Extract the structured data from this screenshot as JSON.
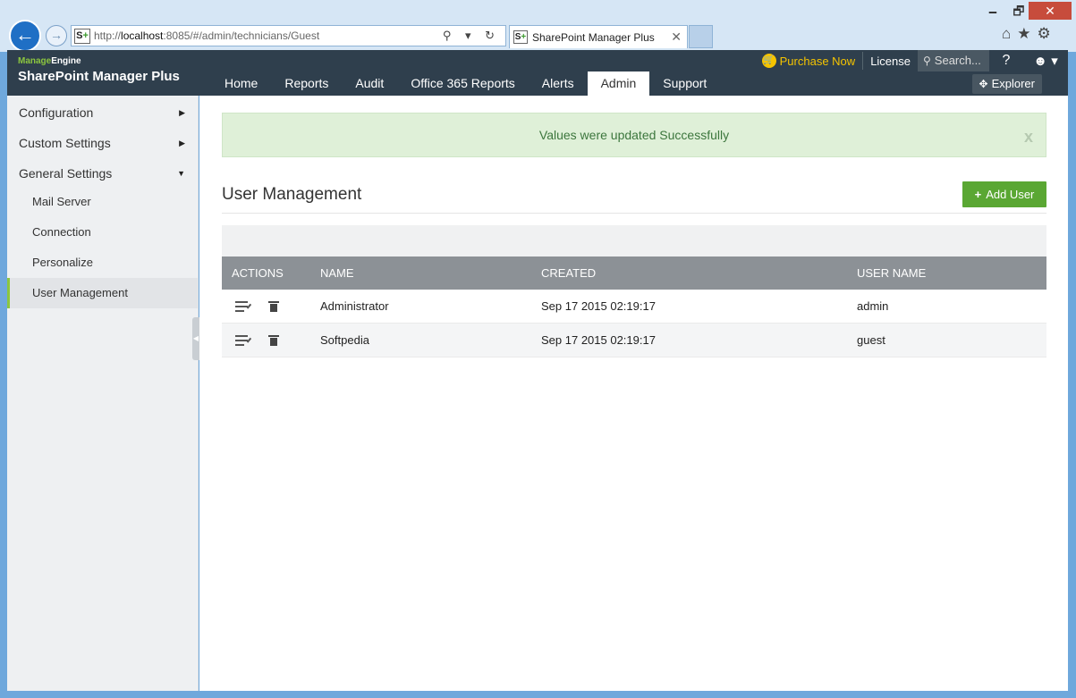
{
  "window": {
    "minimize": "🗕",
    "maximize": "🗗",
    "close": "✕"
  },
  "browser": {
    "back": "←",
    "forward": "→",
    "url_prefix": "http://",
    "url_host": "localhost",
    "url_rest": ":8085/#/admin/technicians/Guest",
    "favicon": "S",
    "favicon_plus": "+",
    "address_icons": "⚲ ▾ ↻",
    "tab_title": "SharePoint Manager Plus",
    "tab_close": "✕",
    "toolbar_icons": "⌂★⚙"
  },
  "header": {
    "brand_small_prefix": "Manage",
    "brand_small_suffix": "Engine",
    "brand_name": "SharePoint Manager Plus",
    "nav": [
      {
        "label": "Home"
      },
      {
        "label": "Reports"
      },
      {
        "label": "Audit"
      },
      {
        "label": "Office 365 Reports"
      },
      {
        "label": "Alerts"
      },
      {
        "label": "Admin"
      },
      {
        "label": "Support"
      }
    ],
    "purchase_label": "Purchase Now",
    "cart_glyph": "🛒",
    "license_label": "License",
    "search_placeholder": "Search...",
    "search_glyph": "⚲",
    "help_glyph": "?",
    "user_glyph": "☻ ▾",
    "explorer_glyph": "✥",
    "explorer_label": "Explorer"
  },
  "sidebar": {
    "sections": [
      {
        "label": "Configuration",
        "caret": "▶"
      },
      {
        "label": "Custom Settings",
        "caret": "▶"
      },
      {
        "label": "General Settings",
        "caret": "▼"
      }
    ],
    "items": [
      {
        "label": "Mail Server"
      },
      {
        "label": "Connection"
      },
      {
        "label": "Personalize"
      },
      {
        "label": "User Management"
      }
    ],
    "collapse_glyph": "◀"
  },
  "main": {
    "alert_text": "Values were updated Successfully",
    "alert_close": "x",
    "title": "User Management",
    "add_user_plus": "+",
    "add_user_label": "Add User",
    "columns": [
      "ACTIONS",
      "NAME",
      "CREATED",
      "USER NAME"
    ],
    "rows": [
      {
        "name": "Administrator",
        "created": "Sep 17 2015 02:19:17",
        "username": "admin"
      },
      {
        "name": "Softpedia",
        "created": "Sep 17 2015 02:19:17",
        "username": "guest"
      }
    ]
  },
  "colors": {
    "header_bg": "#2f3f4d",
    "accent_green": "#5aa733",
    "purchase_yellow": "#f5c400",
    "alert_bg": "#dff0d8",
    "table_header": "#8c9196"
  }
}
